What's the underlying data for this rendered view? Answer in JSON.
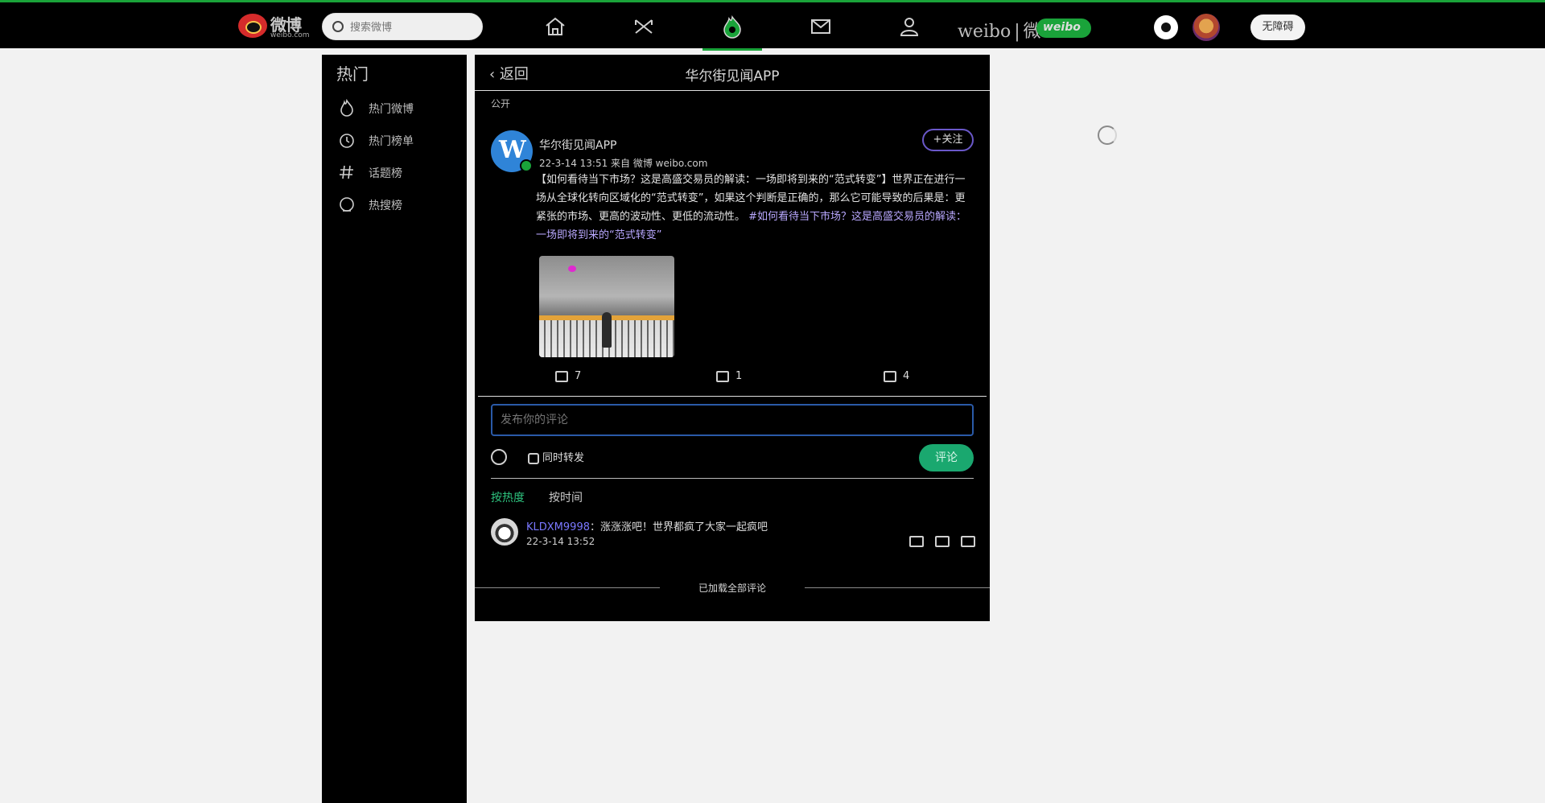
{
  "header": {
    "logo_text": "微博",
    "logo_sub": "weibo.com",
    "search_placeholder": "搜索微博",
    "nav_icons": [
      "home-icon",
      "video-icon",
      "hot-icon",
      "message-icon",
      "profile-icon"
    ],
    "active_nav": "hot-icon",
    "brand_text": "weibo",
    "brand_cn": "微",
    "brand_pill": "weibo",
    "accessibility_label": "无障碍",
    "accent_color": "#1aa33a"
  },
  "sidebar": {
    "title": "热门",
    "items": [
      {
        "label": "热门微博",
        "icon": "flame-icon"
      },
      {
        "label": "热门榜单",
        "icon": "clock-icon"
      },
      {
        "label": "话题榜",
        "icon": "hashtag-icon"
      },
      {
        "label": "热搜榜",
        "icon": "search-trend-icon"
      }
    ]
  },
  "card": {
    "back_label": "返回",
    "title": "华尔街见闻APP",
    "visibility": "公开",
    "post": {
      "author": "华尔街见闻APP",
      "meta": "22-3-14 13:51 来自 微博 weibo.com",
      "follow_label": "+关注",
      "text": "【如何看待当下市场？这是高盛交易员的解读：一场即将到来的“范式转变”】世界正在进行一场从全球化转向区域化的“范式转变”，如果这个判断是正确的，那么它可能导致的后果是：更紧张的市场、更高的波动性、更低的流动性。",
      "text_link": "#如何看待当下市场？这是高盛交易员的解读：一场即将到来的“范式转变”",
      "reposts": "7",
      "comments": "1",
      "likes": "4"
    },
    "comment_input_placeholder": "发布你的评论",
    "repost_option": "同时转发",
    "submit_label": "评论",
    "sort_hot": "按热度",
    "sort_time": "按时间",
    "comments_list": [
      {
        "user": "KLDXM9998",
        "text": "：涨涨涨吧！世界都疯了大家一起疯吧",
        "time": "22-3-14 13:52"
      }
    ],
    "loaded_all": "已加载全部评论"
  }
}
